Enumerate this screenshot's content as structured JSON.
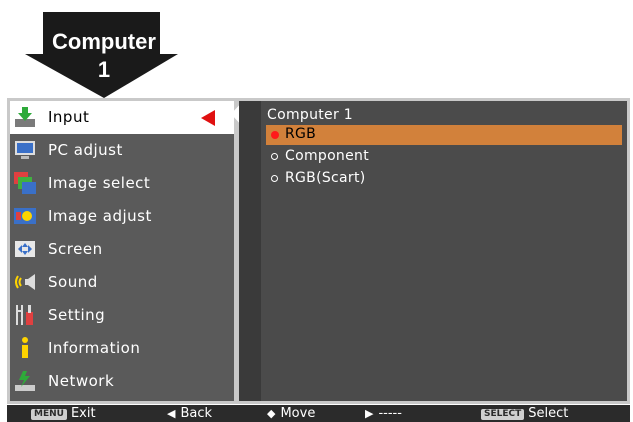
{
  "badge": {
    "line1": "Computer",
    "line2": "1"
  },
  "sidebar": {
    "items": [
      {
        "label": "Input",
        "icon": "input-icon",
        "selected": true
      },
      {
        "label": "PC adjust",
        "icon": "pc-adjust-icon"
      },
      {
        "label": "Image select",
        "icon": "image-select-icon"
      },
      {
        "label": "Image adjust",
        "icon": "image-adjust-icon"
      },
      {
        "label": "Screen",
        "icon": "screen-icon"
      },
      {
        "label": "Sound",
        "icon": "sound-icon"
      },
      {
        "label": "Setting",
        "icon": "setting-icon"
      },
      {
        "label": "Information",
        "icon": "information-icon"
      },
      {
        "label": "Network",
        "icon": "network-icon"
      }
    ]
  },
  "panel": {
    "title": "Computer 1",
    "options": [
      {
        "label": "RGB",
        "selected": true
      },
      {
        "label": "Component"
      },
      {
        "label": "RGB(Scart)"
      }
    ]
  },
  "footer": {
    "exit": {
      "key": "MENU",
      "label": "Exit"
    },
    "back": {
      "glyph": "◀",
      "label": "Back"
    },
    "move": {
      "glyph": "◆",
      "label": "Move"
    },
    "next": {
      "glyph": "▶",
      "label": "-----"
    },
    "select": {
      "key": "SELECT",
      "label": "Select"
    }
  },
  "colors": {
    "highlight": "#d2813b",
    "pointer": "#e01010",
    "sidebar": "#5a5a5a",
    "panel": "#4b4b4b"
  }
}
